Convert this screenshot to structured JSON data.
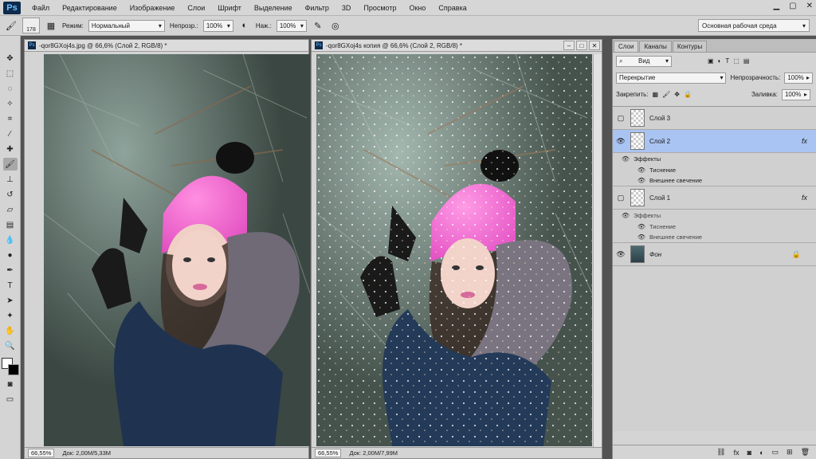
{
  "menubar": {
    "logo": "Ps",
    "items": [
      "Файл",
      "Редактирование",
      "Изображение",
      "Слои",
      "Шрифт",
      "Выделение",
      "Фильтр",
      "3D",
      "Просмотр",
      "Окно",
      "Справка"
    ]
  },
  "options": {
    "brush_size": "178",
    "mode_label": "Режим:",
    "mode_value": "Нормальный",
    "opacity_label": "Непрозр.:",
    "opacity_value": "100%",
    "pressure_label": "Наж.:",
    "pressure_value": "100%",
    "workspace": "Основная рабочая среда"
  },
  "doc1": {
    "title": "-qor8GXoj4s.jpg @ 66,6% (Слой 2, RGB/8) *",
    "zoom": "66,55%",
    "doc_info": "Док: 2,00M/5,33M"
  },
  "doc2": {
    "title": "-qor8GXoj4s копия @ 66,6% (Слой 2, RGB/8) *",
    "zoom": "66,55%",
    "doc_info": "Док: 2,00M/7,99M"
  },
  "panel": {
    "tabs": [
      "Слои",
      "Каналы",
      "Контуры"
    ],
    "filter_kind": "Вид",
    "blend_mode": "Перекрытие",
    "opacity_label": "Непрозрачность:",
    "opacity_value": "100%",
    "lock_label": "Закрепить:",
    "fill_label": "Заливка:",
    "fill_value": "100%",
    "layers": [
      {
        "name": "Слой 3"
      },
      {
        "name": "Слой 2",
        "effects": "Эффекты",
        "fx1": "Тиснение",
        "fx2": "Внешнее свечение"
      },
      {
        "name": "Слой 1",
        "effects": "Эффекты",
        "fx1": "Тиснение",
        "fx2": "Внешнее свечение"
      },
      {
        "name": "Фон"
      }
    ],
    "fx_symbol": "fx"
  },
  "icons": [
    "move-icon",
    "marquee-icon",
    "lasso-icon",
    "quick-select-icon",
    "crop-icon",
    "eyedropper-icon",
    "healing-icon",
    "brush-icon",
    "stamp-icon",
    "history-brush-icon",
    "eraser-icon",
    "gradient-icon",
    "blur-icon",
    "dodge-icon",
    "pen-icon",
    "type-icon",
    "path-select-icon",
    "shape-icon",
    "hand-icon",
    "zoom-icon"
  ]
}
